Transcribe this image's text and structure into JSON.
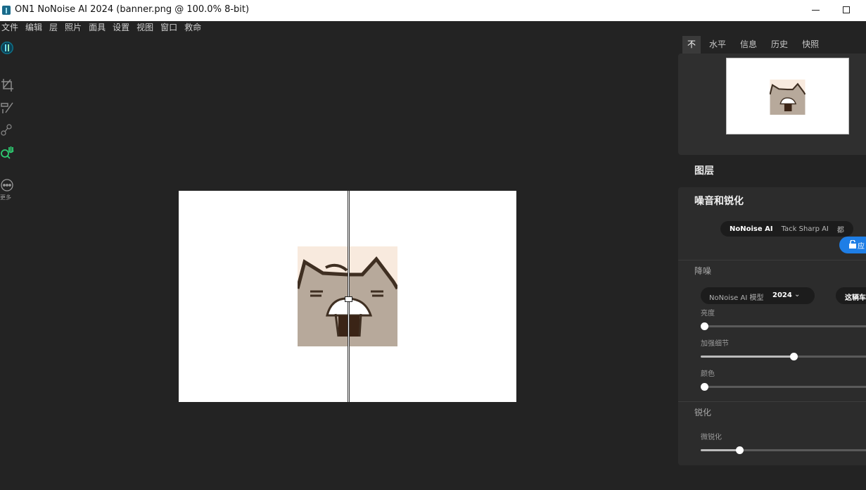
{
  "window": {
    "title": "ON1 NoNoise AI 2024 (banner.png @ 100.0% 8-bit)"
  },
  "menu": [
    "文件",
    "编辑",
    "层",
    "照片",
    "面具",
    "设置",
    "视图",
    "窗口",
    "救命"
  ],
  "toolbar": {
    "tools": [
      "nonoise-tool-icon",
      "crop-icon",
      "retouch-brush-icon",
      "transform-icon",
      "zoom-hand-icon",
      "more-icon"
    ],
    "more_label": "更多",
    "accent": "#2ecc71"
  },
  "panel_tabs": [
    "不",
    "水平",
    "信息",
    "历史",
    "快照"
  ],
  "active_tab": "不",
  "layers_label": "图层",
  "noise_panel": {
    "title": "噪音和锐化",
    "modes": [
      "NoNoise AI",
      "Tack Sharp AI",
      "都"
    ],
    "active_mode": "NoNoise AI",
    "apply_label": "应",
    "apply_color": "#1e7ee6",
    "denoise_section": "降噪",
    "model_label": "NoNoise AI 模型",
    "model_value": "2024",
    "detect_label": "这辆车",
    "sliders": [
      {
        "label": "亮度",
        "value": 0
      },
      {
        "label": "加强细节",
        "value": 55
      },
      {
        "label": "颜色",
        "value": 0
      }
    ],
    "sharpen_section": "锐化",
    "sharpen_sliders": [
      {
        "label": "微锐化",
        "value": 23
      }
    ]
  }
}
